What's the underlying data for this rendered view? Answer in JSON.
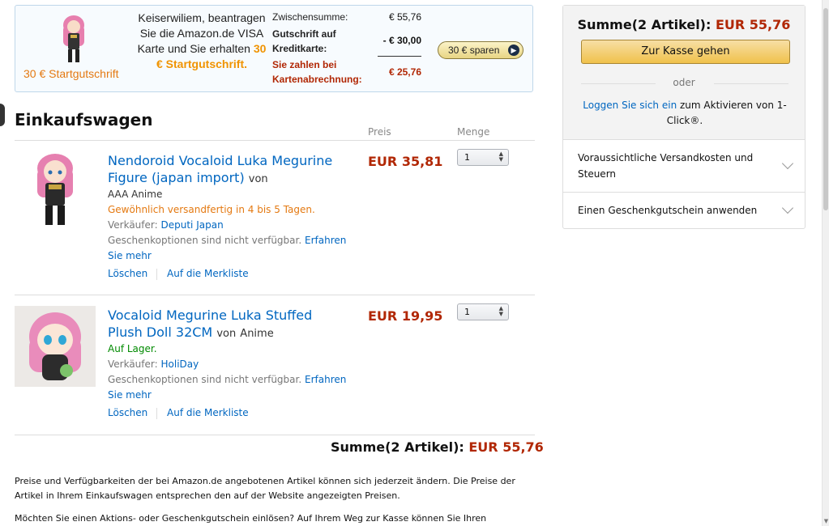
{
  "promo": {
    "credit_label": "30 € Startgutschrift",
    "text_pre": "Keiserwiliem, beantragen Sie die Amazon.de VISA Karte und Sie erhalten ",
    "text_highlight": "30 € Startgutschrift.",
    "subtotal_label": "Zwischensumme:",
    "subtotal_value": "€ 55,76",
    "credit_line_label": "Gutschrift auf Kreditkarte:",
    "credit_line_value": "- € 30,00",
    "pay_label": "Sie zahlen bei Kartenabrechnung:",
    "pay_value": "€ 25,76",
    "save_button": "30 € sparen"
  },
  "cart": {
    "title": "Einkaufswagen",
    "col_price": "Preis",
    "col_qty": "Menge",
    "items": [
      {
        "title": "Nendoroid Vocaloid Luka Megurine Figure (japan import)",
        "by_prefix": "von",
        "by": "AAA Anime",
        "availability": "Gewöhnlich versandfertig in 4 bis 5 Tagen.",
        "seller_label": "Verkäufer:",
        "seller": "Deputi Japan",
        "gift_text": "Geschenkoptionen sind nicht verfügbar.",
        "learn_more": "Erfahren Sie mehr",
        "price": "EUR 35,81",
        "qty": "1",
        "delete": "Löschen",
        "wishlist": "Auf die Merkliste"
      },
      {
        "title": "Vocaloid Megurine Luka Stuffed Plush Doll 32CM",
        "by_prefix": "von",
        "by": "Anime",
        "availability": "Auf Lager.",
        "seller_label": "Verkäufer:",
        "seller": "HoliDay",
        "gift_text": "Geschenkoptionen sind nicht verfügbar.",
        "learn_more": "Erfahren Sie mehr",
        "price": "EUR 19,95",
        "qty": "1",
        "delete": "Löschen",
        "wishlist": "Auf die Merkliste"
      }
    ],
    "total_label": "Summe(2 Artikel):",
    "total_value": "EUR 55,76",
    "notice1": "Preise und Verfügbarkeiten der bei Amazon.de angebotenen Artikel können sich jederzeit ändern. Die Preise der Artikel in Ihrem Einkaufswagen entsprechen den auf der Website angezeigten Preisen.",
    "notice2": "Möchten Sie einen Aktions- oder Geschenkgutschein einlösen? Auf Ihrem Weg zur Kasse können Sie Ihren"
  },
  "sidebar": {
    "total_label": "Summe(2 Artikel):",
    "total_value": "EUR 55,76",
    "checkout_button": "Zur Kasse gehen",
    "or": "oder",
    "login_link": "Loggen Sie sich ein",
    "login_rest": " zum Aktivieren von 1-Click®.",
    "shipping_accordion": "Voraussichtliche Versandkosten und Steuern",
    "voucher_accordion": "Einen Geschenkgutschein anwenden"
  },
  "colors": {
    "price_red": "#b12704",
    "link_blue": "#0066c0",
    "in_stock_green": "#008a00",
    "promo_orange": "#e47911",
    "checkout_yellow": "#f0c14b"
  }
}
